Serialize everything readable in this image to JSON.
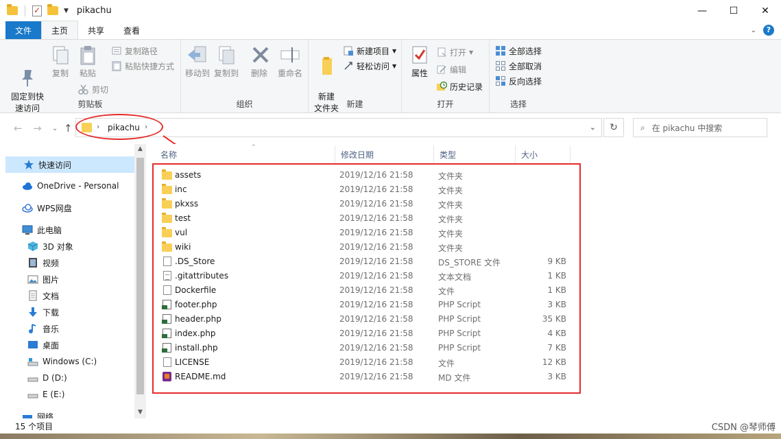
{
  "window": {
    "title": "pikachu"
  },
  "tabs": [
    "文件",
    "主页",
    "共享",
    "查看"
  ],
  "ribbon": {
    "clipboard": {
      "label": "剪贴板",
      "pin": "固定到快\n速访问",
      "copy": "复制",
      "paste": "粘贴",
      "copy_path": "复制路径",
      "paste_shortcut": "粘贴快捷方式",
      "cut": "剪切"
    },
    "organize": {
      "label": "组织",
      "move_to": "移动到",
      "copy_to": "复制到",
      "delete": "删除",
      "rename": "重命名"
    },
    "new": {
      "label": "新建",
      "new_folder": "新建\n文件夹",
      "new_item": "新建项目",
      "easy_access": "轻松访问"
    },
    "open": {
      "label": "打开",
      "properties": "属性",
      "open": "打开",
      "edit": "编辑",
      "history": "历史记录"
    },
    "select": {
      "label": "选择",
      "select_all": "全部选择",
      "select_none": "全部取消",
      "invert": "反向选择"
    }
  },
  "address": {
    "crumb": "pikachu",
    "search_placeholder": "在 pikachu 中搜索"
  },
  "nav": {
    "items": [
      {
        "label": "快速访问",
        "icon": "star-icon"
      },
      {
        "label": "OneDrive - Personal",
        "icon": "cloud-icon"
      },
      {
        "label": "WPS网盘",
        "icon": "wps-cloud-icon"
      },
      {
        "label": "此电脑",
        "icon": "computer-icon"
      },
      {
        "label": "3D 对象",
        "icon": "cube-icon"
      },
      {
        "label": "视频",
        "icon": "video-icon"
      },
      {
        "label": "图片",
        "icon": "picture-icon"
      },
      {
        "label": "文档",
        "icon": "document-icon"
      },
      {
        "label": "下载",
        "icon": "download-icon"
      },
      {
        "label": "音乐",
        "icon": "music-icon"
      },
      {
        "label": "桌面",
        "icon": "desktop-icon"
      },
      {
        "label": "Windows (C:)",
        "icon": "drive-icon"
      },
      {
        "label": "D (D:)",
        "icon": "drive-icon"
      },
      {
        "label": "E (E:)",
        "icon": "drive-icon"
      },
      {
        "label": "网络",
        "icon": "network-icon"
      }
    ]
  },
  "columns": [
    "名称",
    "修改日期",
    "类型",
    "大小"
  ],
  "files": [
    {
      "name": "assets",
      "date": "2019/12/16 21:58",
      "type": "文件夹",
      "size": "",
      "icon": "folder"
    },
    {
      "name": "inc",
      "date": "2019/12/16 21:58",
      "type": "文件夹",
      "size": "",
      "icon": "folder"
    },
    {
      "name": "pkxss",
      "date": "2019/12/16 21:58",
      "type": "文件夹",
      "size": "",
      "icon": "folder"
    },
    {
      "name": "test",
      "date": "2019/12/16 21:58",
      "type": "文件夹",
      "size": "",
      "icon": "folder"
    },
    {
      "name": "vul",
      "date": "2019/12/16 21:58",
      "type": "文件夹",
      "size": "",
      "icon": "folder"
    },
    {
      "name": "wiki",
      "date": "2019/12/16 21:58",
      "type": "文件夹",
      "size": "",
      "icon": "folder"
    },
    {
      "name": ".DS_Store",
      "date": "2019/12/16 21:58",
      "type": "DS_STORE 文件",
      "size": "9 KB",
      "icon": "doc"
    },
    {
      "name": ".gitattributes",
      "date": "2019/12/16 21:58",
      "type": "文本文档",
      "size": "1 KB",
      "icon": "doc lined"
    },
    {
      "name": "Dockerfile",
      "date": "2019/12/16 21:58",
      "type": "文件",
      "size": "1 KB",
      "icon": "doc"
    },
    {
      "name": "footer.php",
      "date": "2019/12/16 21:58",
      "type": "PHP Script",
      "size": "3 KB",
      "icon": "php"
    },
    {
      "name": "header.php",
      "date": "2019/12/16 21:58",
      "type": "PHP Script",
      "size": "35 KB",
      "icon": "php"
    },
    {
      "name": "index.php",
      "date": "2019/12/16 21:58",
      "type": "PHP Script",
      "size": "4 KB",
      "icon": "php"
    },
    {
      "name": "install.php",
      "date": "2019/12/16 21:58",
      "type": "PHP Script",
      "size": "7 KB",
      "icon": "php"
    },
    {
      "name": "LICENSE",
      "date": "2019/12/16 21:58",
      "type": "文件",
      "size": "12 KB",
      "icon": "doc"
    },
    {
      "name": "README.md",
      "date": "2019/12/16 21:58",
      "type": "MD 文件",
      "size": "3 KB",
      "icon": "md"
    }
  ],
  "status": {
    "count": "15 个项目"
  },
  "watermark": "CSDN @琴师傅",
  "colors": {
    "accent": "#1979ca",
    "annotation": "#e52b2b",
    "selection": "#cce8ff"
  }
}
